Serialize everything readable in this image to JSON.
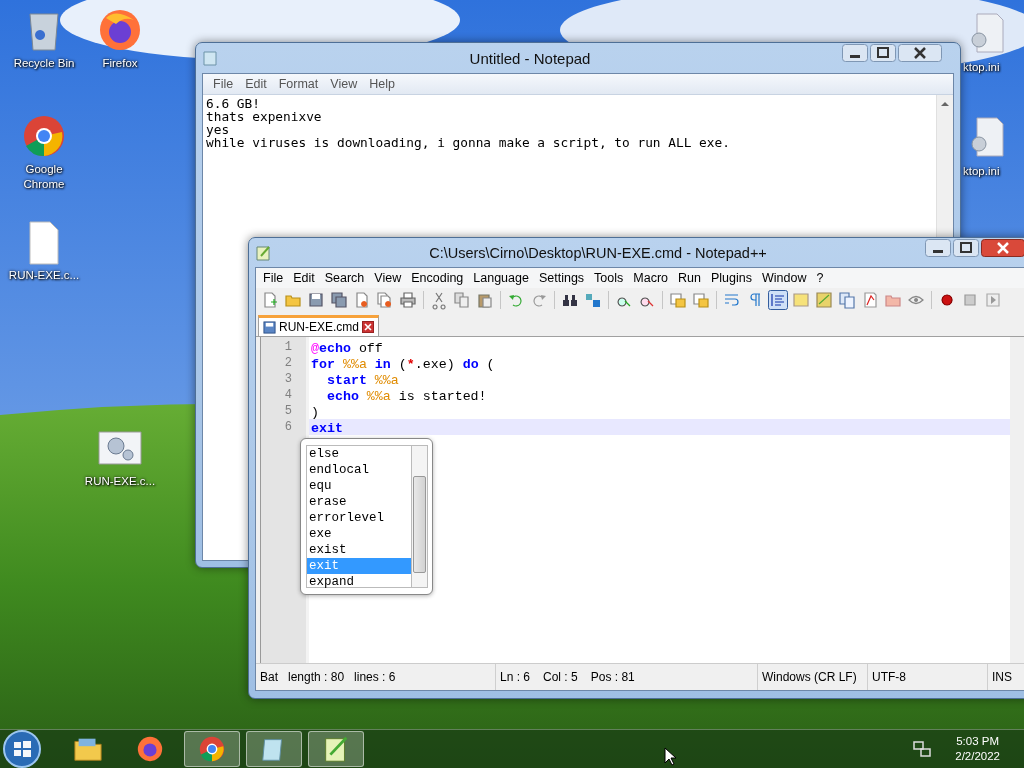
{
  "desktop_icons": [
    {
      "label": "Recycle Bin",
      "kind": "trash"
    },
    {
      "label": "Firefox",
      "kind": "firefox"
    },
    {
      "label": "Google Chrome",
      "kind": "chrome"
    },
    {
      "label": "RUN-EXE.c...",
      "kind": "file"
    },
    {
      "label": "RUN-EXE.c...",
      "kind": "cmd"
    },
    {
      "label": "ktop.ini",
      "kind": "ini"
    },
    {
      "label": "ktop.ini",
      "kind": "ini"
    }
  ],
  "notepad": {
    "title": "Untitled - Notepad",
    "menu": [
      "File",
      "Edit",
      "Format",
      "View",
      "Help"
    ],
    "lines": [
      "6.6 GB!",
      "thats expenixve",
      "yes",
      "while viruses is downloading, i gonna make a script, to run ALL exe."
    ]
  },
  "notepadpp": {
    "title": "C:\\Users\\Cirno\\Desktop\\RUN-EXE.cmd - Notepad++",
    "menu": [
      "File",
      "Edit",
      "Search",
      "View",
      "Encoding",
      "Language",
      "Settings",
      "Tools",
      "Macro",
      "Run",
      "Plugins",
      "Window",
      "?"
    ],
    "toolbar": [
      {
        "kind": "new",
        "pressed": false
      },
      {
        "kind": "open",
        "pressed": false
      },
      {
        "kind": "save",
        "pressed": false
      },
      {
        "kind": "saveall",
        "pressed": false
      },
      {
        "kind": "close",
        "pressed": false
      },
      {
        "kind": "closeall",
        "pressed": false
      },
      {
        "kind": "print",
        "pressed": false
      },
      {
        "kind": "sep"
      },
      {
        "kind": "cut",
        "pressed": false
      },
      {
        "kind": "copy",
        "pressed": false
      },
      {
        "kind": "paste",
        "pressed": false
      },
      {
        "kind": "sep"
      },
      {
        "kind": "undo",
        "pressed": false
      },
      {
        "kind": "redo",
        "pressed": false
      },
      {
        "kind": "sep"
      },
      {
        "kind": "find",
        "pressed": false
      },
      {
        "kind": "replace",
        "pressed": false
      },
      {
        "kind": "sep"
      },
      {
        "kind": "zoomin",
        "pressed": false
      },
      {
        "kind": "zoomout",
        "pressed": false
      },
      {
        "kind": "sep"
      },
      {
        "kind": "syncv",
        "pressed": false
      },
      {
        "kind": "synch",
        "pressed": false
      },
      {
        "kind": "sep"
      },
      {
        "kind": "wrap",
        "pressed": false
      },
      {
        "kind": "pilcrow",
        "pressed": false
      },
      {
        "kind": "indent",
        "pressed": true
      },
      {
        "kind": "panel",
        "pressed": false
      },
      {
        "kind": "map",
        "pressed": false
      },
      {
        "kind": "doclist",
        "pressed": false
      },
      {
        "kind": "function",
        "pressed": false
      },
      {
        "kind": "folder",
        "pressed": false
      },
      {
        "kind": "eye",
        "pressed": false
      },
      {
        "kind": "sep"
      },
      {
        "kind": "record",
        "pressed": false
      },
      {
        "kind": "stop",
        "pressed": false
      },
      {
        "kind": "play",
        "pressed": false
      }
    ],
    "tab": {
      "label": "RUN-EXE.cmd"
    },
    "code": [
      {
        "number": "1",
        "current": false,
        "tokens": [
          {
            "t": "@",
            "kind": "at"
          },
          {
            "t": "echo",
            "kind": "keyword"
          },
          {
            "t": " off",
            "kind": "text"
          }
        ]
      },
      {
        "number": "2",
        "current": false,
        "tokens": [
          {
            "t": "for",
            "kind": "keyword"
          },
          {
            "t": " %%a",
            "kind": "variable"
          },
          {
            "t": " in",
            "kind": "keyword"
          },
          {
            "t": " (",
            "kind": "text"
          },
          {
            "t": "*",
            "kind": "operator"
          },
          {
            "t": ".exe) ",
            "kind": "text"
          },
          {
            "t": "do",
            "kind": "keyword"
          },
          {
            "t": " (",
            "kind": "text"
          }
        ]
      },
      {
        "number": "3",
        "current": false,
        "tokens": [
          {
            "t": "  start",
            "kind": "keyword"
          },
          {
            "t": " %%a",
            "kind": "variable"
          }
        ]
      },
      {
        "number": "4",
        "current": false,
        "tokens": [
          {
            "t": "  echo",
            "kind": "keyword"
          },
          {
            "t": " %%a",
            "kind": "variable"
          },
          {
            "t": " is started!",
            "kind": "text"
          }
        ]
      },
      {
        "number": "5",
        "current": false,
        "tokens": [
          {
            "t": ")",
            "kind": "text"
          }
        ]
      },
      {
        "number": "6",
        "current": true,
        "tokens": [
          {
            "t": "exit",
            "kind": "keyword"
          }
        ]
      }
    ],
    "autocomplete": [
      {
        "label": "else",
        "selected": false
      },
      {
        "label": "endlocal",
        "selected": false
      },
      {
        "label": "equ",
        "selected": false
      },
      {
        "label": "erase",
        "selected": false
      },
      {
        "label": "errorlevel",
        "selected": false
      },
      {
        "label": "exe",
        "selected": false
      },
      {
        "label": "exist",
        "selected": false
      },
      {
        "label": "exit",
        "selected": true
      },
      {
        "label": "expand",
        "selected": false
      }
    ],
    "status_bar": {
      "language": "Bat",
      "length": "length : 80",
      "lines": "lines : 6",
      "ln": "Ln : 6",
      "col": "Col : 5",
      "pos": "Pos : 81",
      "eol": "Windows (CR LF)",
      "encoding": "UTF-8",
      "mode": "INS"
    }
  },
  "taskbar": {
    "items": [
      {
        "kind": "explorer",
        "running": false
      },
      {
        "kind": "firefox",
        "running": false
      },
      {
        "kind": "chrome",
        "running": true
      },
      {
        "kind": "notepad",
        "running": true
      },
      {
        "kind": "notepadpp",
        "running": true
      }
    ],
    "time": "5:03 PM",
    "date": "2/2/2022"
  }
}
